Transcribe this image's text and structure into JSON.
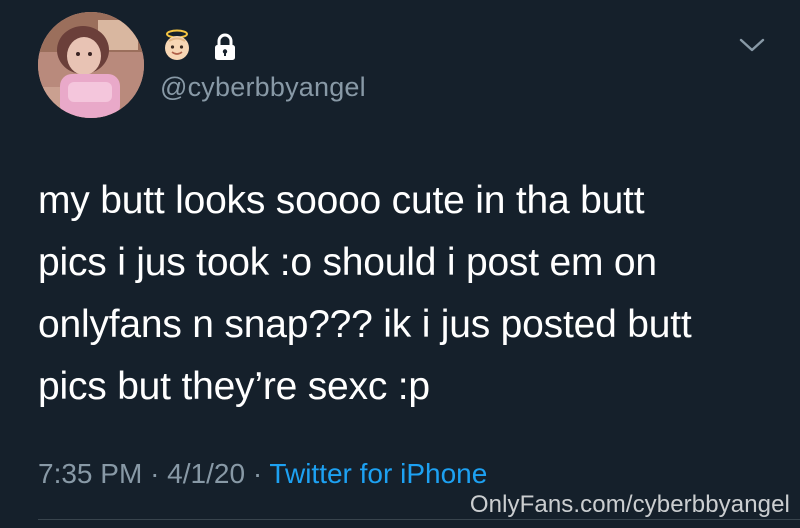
{
  "tweet": {
    "handle": "@cyberbbyangel",
    "name_emoji": "baby-angel-emoji",
    "body_lines": [
      "my butt looks soooo cute in tha butt",
      "pics i jus took :o should i post em on",
      "onlyfans n snap??? ik i jus posted butt",
      "pics but they’re sexc :p"
    ],
    "time": "7:35 PM",
    "date": "4/1/20",
    "separator": "·",
    "source": "Twitter for iPhone"
  },
  "watermark": "OnlyFans.com/cyberbbyangel",
  "icons": {
    "angel": "angel-face-icon",
    "lock": "lock-icon",
    "chevron": "chevron-down-icon"
  },
  "colors": {
    "background": "#15202b",
    "text": "#ffffff",
    "muted": "#8899a6",
    "link": "#1da1f2"
  }
}
